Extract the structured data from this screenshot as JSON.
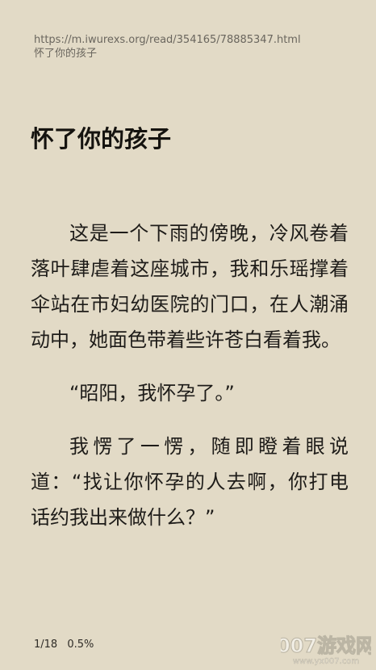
{
  "header": {
    "url": "https://m.iwurexs.org/read/354165/78885347.html",
    "title": "怀了你的孩子"
  },
  "chapter": {
    "title": "怀了你的孩子",
    "paragraphs": [
      "这是一个下雨的傍晚，冷风卷着落叶肆虐着这座城市，我和乐瑶撑着伞站在市妇幼医院的门口，在人潮涌动中，她面色带着些许苍白看着我。",
      "“昭阳，我怀孕了。”",
      "我愣了一愣，随即瞪着眼说道：“找让你怀孕的人去啊，你打电话约我出来做什么？”"
    ]
  },
  "footer": {
    "page": "1/18",
    "percent": "0.5%"
  },
  "watermark": {
    "brand": "007游戏网",
    "url": "www.yx007.com"
  }
}
